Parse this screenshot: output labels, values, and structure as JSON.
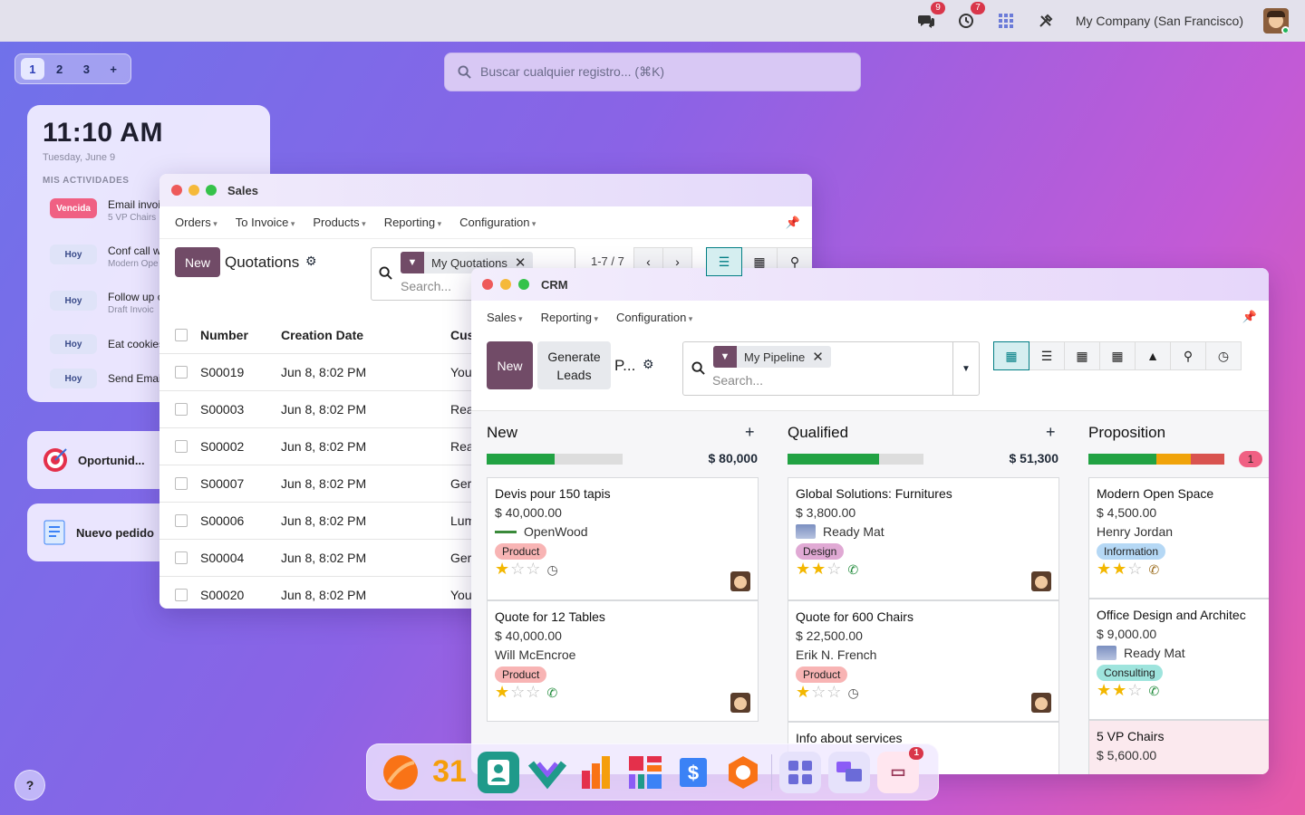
{
  "topbar": {
    "messages_badge": "9",
    "activities_badge": "7",
    "company": "My Company (San Francisco)"
  },
  "workspaces": [
    "1",
    "2",
    "3",
    "+"
  ],
  "global_search": {
    "placeholder": "Buscar cualquier registro... (⌘K)"
  },
  "panel": {
    "time": "11:10 AM",
    "date": "Tuesday, June 9",
    "activities_title": "MIS ACTIVIDADES",
    "activities": [
      {
        "tag": "Vencida",
        "title": "Email invoi",
        "sub": "5 VP Chairs"
      },
      {
        "tag": "Hoy",
        "title": "Conf call w",
        "sub": "Modern Ope"
      },
      {
        "tag": "Hoy",
        "title": "Follow up c",
        "sub": "Draft Invoic"
      },
      {
        "tag": "Hoy",
        "title": "Eat cookies",
        "sub": ""
      },
      {
        "tag": "Hoy",
        "title": "Send Email",
        "sub": ""
      }
    ],
    "card1": "Oportunid...",
    "card2": "Nuevo pedido"
  },
  "sales": {
    "title": "Sales",
    "menu": [
      "Orders",
      "To Invoice",
      "Products",
      "Reporting",
      "Configuration"
    ],
    "new_label": "New",
    "page_title": "Quotations",
    "facet": "My Quotations",
    "search_placeholder": "Search...",
    "pager": "1-7 / 7",
    "headers": {
      "number": "Number",
      "date": "Creation Date",
      "customer": "Cus"
    },
    "rows": [
      {
        "number": "S00019",
        "date": "Jun 8, 8:02 PM",
        "customer": "You"
      },
      {
        "number": "S00003",
        "date": "Jun 8, 8:02 PM",
        "customer": "Rea"
      },
      {
        "number": "S00002",
        "date": "Jun 8, 8:02 PM",
        "customer": "Rea"
      },
      {
        "number": "S00007",
        "date": "Jun 8, 8:02 PM",
        "customer": "Ger"
      },
      {
        "number": "S00006",
        "date": "Jun 8, 8:02 PM",
        "customer": "Lum"
      },
      {
        "number": "S00004",
        "date": "Jun 8, 8:02 PM",
        "customer": "Ger"
      },
      {
        "number": "S00020",
        "date": "Jun 8, 8:02 PM",
        "customer": "You"
      }
    ]
  },
  "crm": {
    "title": "CRM",
    "menu": [
      "Sales",
      "Reporting",
      "Configuration"
    ],
    "new_label": "New",
    "generate_label": "Generate\nLeads",
    "page_title": "P...",
    "facet": "My Pipeline",
    "search_placeholder": "Search...",
    "columns": [
      {
        "name": "New",
        "total": "$ 80,000",
        "progress": {
          "green": 0.5,
          "orange": 0,
          "red": 0
        },
        "cards": [
          {
            "name": "Devis pour 150 tapis",
            "amount": "$ 40,000.00",
            "customer": "OpenWood",
            "tag": "Product",
            "stars": 1
          },
          {
            "name": "Quote for 12 Tables",
            "amount": "$ 40,000.00",
            "customer": "Will McEncroe",
            "tag": "Product",
            "stars": 1
          }
        ]
      },
      {
        "name": "Qualified",
        "total": "$ 51,300",
        "progress": {
          "green": 0.67,
          "orange": 0,
          "red": 0
        },
        "cards": [
          {
            "name": "Global Solutions: Furnitures",
            "amount": "$ 3,800.00",
            "customer": "Ready Mat",
            "tag": "Design",
            "stars": 2
          },
          {
            "name": "Quote for 600 Chairs",
            "amount": "$ 22,500.00",
            "customer": "Erik N. French",
            "tag": "Product",
            "stars": 1
          },
          {
            "name": "Info about services",
            "amount": "",
            "customer": "",
            "tag": "",
            "stars": 0
          }
        ]
      },
      {
        "name": "Proposition",
        "total": "1",
        "progress": {
          "green": 0.5,
          "orange": 0.25,
          "red": 0.25
        },
        "cards": [
          {
            "name": "Modern Open Space",
            "amount": "$ 4,500.00",
            "customer": "Henry Jordan",
            "tag": "Information",
            "stars": 2
          },
          {
            "name": "Office Design and Architec",
            "amount": "$ 9,000.00",
            "customer": "Ready Mat",
            "tag": "Consulting",
            "stars": 2
          },
          {
            "name": "5 VP Chairs",
            "amount": "$ 5,600.00",
            "customer": "",
            "tag": "",
            "stars": 0
          }
        ]
      }
    ]
  },
  "dock": {
    "calendar_label": "31",
    "discuss_badge": "1"
  },
  "help": "?"
}
